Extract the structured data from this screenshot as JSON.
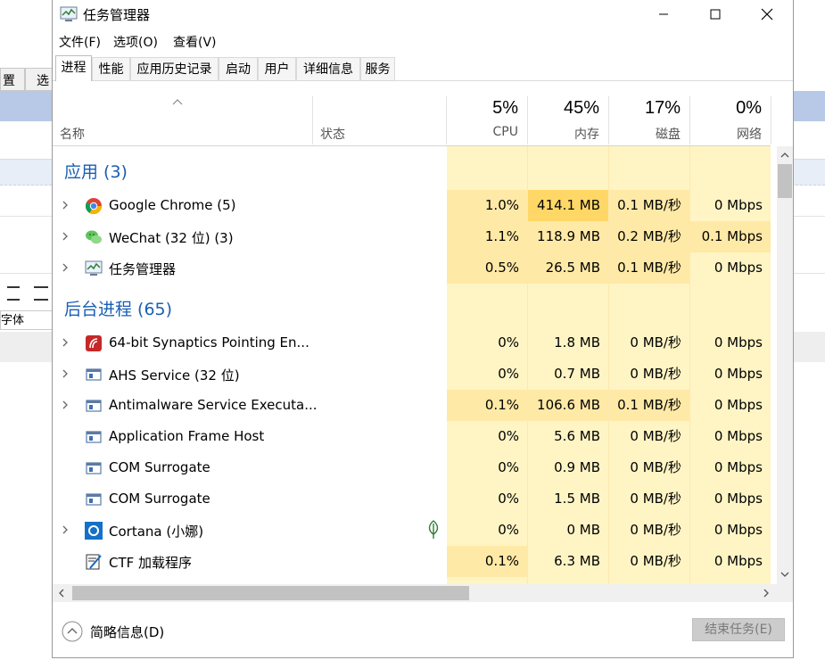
{
  "background_app": {
    "tab1": "置",
    "tab2": "选",
    "font_label": "字体"
  },
  "window": {
    "title": "任务管理器",
    "controls": {
      "minimize": "—",
      "maximize": "☐",
      "close": "✕"
    }
  },
  "menu": [
    "文件(F)",
    "选项(O)",
    "查看(V)"
  ],
  "tabs": [
    "进程",
    "性能",
    "应用历史记录",
    "启动",
    "用户",
    "详细信息",
    "服务"
  ],
  "columns": {
    "name": "名称",
    "status": "状态",
    "cpu": {
      "percent": "5%",
      "label": "CPU"
    },
    "memory": {
      "percent": "45%",
      "label": "内存"
    },
    "disk": {
      "percent": "17%",
      "label": "磁盘"
    },
    "network": {
      "percent": "0%",
      "label": "网络"
    }
  },
  "groups": {
    "apps": "应用 (3)",
    "background": "后台进程 (65)"
  },
  "apps": [
    {
      "name": "Google Chrome (5)",
      "cpu": "1.0%",
      "memory": "414.1 MB",
      "disk": "0.1 MB/秒",
      "network": "0 Mbps",
      "icon": "chrome-icon"
    },
    {
      "name": "WeChat (32 位) (3)",
      "cpu": "1.1%",
      "memory": "118.9 MB",
      "disk": "0.2 MB/秒",
      "network": "0.1 Mbps",
      "icon": "wechat-icon"
    },
    {
      "name": "任务管理器",
      "cpu": "0.5%",
      "memory": "26.5 MB",
      "disk": "0.1 MB/秒",
      "network": "0 Mbps",
      "icon": "task-manager-icon"
    }
  ],
  "background_processes": [
    {
      "name": "64-bit Synaptics Pointing En...",
      "cpu": "0%",
      "memory": "1.8 MB",
      "disk": "0 MB/秒",
      "network": "0 Mbps",
      "icon": "synaptics-icon"
    },
    {
      "name": "AHS Service (32 位)",
      "cpu": "0%",
      "memory": "0.7 MB",
      "disk": "0 MB/秒",
      "network": "0 Mbps",
      "icon": "service-window-icon"
    },
    {
      "name": "Antimalware Service Executa...",
      "cpu": "0.1%",
      "memory": "106.6 MB",
      "disk": "0.1 MB/秒",
      "network": "0 Mbps",
      "icon": "service-window-icon"
    },
    {
      "name": "Application Frame Host",
      "cpu": "0%",
      "memory": "5.6 MB",
      "disk": "0 MB/秒",
      "network": "0 Mbps",
      "icon": "service-window-icon"
    },
    {
      "name": "COM Surrogate",
      "cpu": "0%",
      "memory": "0.9 MB",
      "disk": "0 MB/秒",
      "network": "0 Mbps",
      "icon": "service-window-icon"
    },
    {
      "name": "COM Surrogate",
      "cpu": "0%",
      "memory": "1.5 MB",
      "disk": "0 MB/秒",
      "network": "0 Mbps",
      "icon": "service-window-icon"
    },
    {
      "name": "Cortana (小娜)",
      "cpu": "0%",
      "memory": "0 MB",
      "disk": "0 MB/秒",
      "network": "0 Mbps",
      "icon": "cortana-icon"
    },
    {
      "name": "CTF 加载程序",
      "cpu": "0.1%",
      "memory": "6.3 MB",
      "disk": "0 MB/秒",
      "network": "0 Mbps",
      "icon": "ctf-loader-icon"
    }
  ],
  "footer": {
    "fewer_details": "简略信息(D)",
    "end_task": "结束任务(E)"
  },
  "colors": {
    "heat_light": "#fff4c4",
    "heat_medium": "#ffe9a6",
    "heat_strong": "#ffd766",
    "group_text": "#1a5fb4"
  }
}
